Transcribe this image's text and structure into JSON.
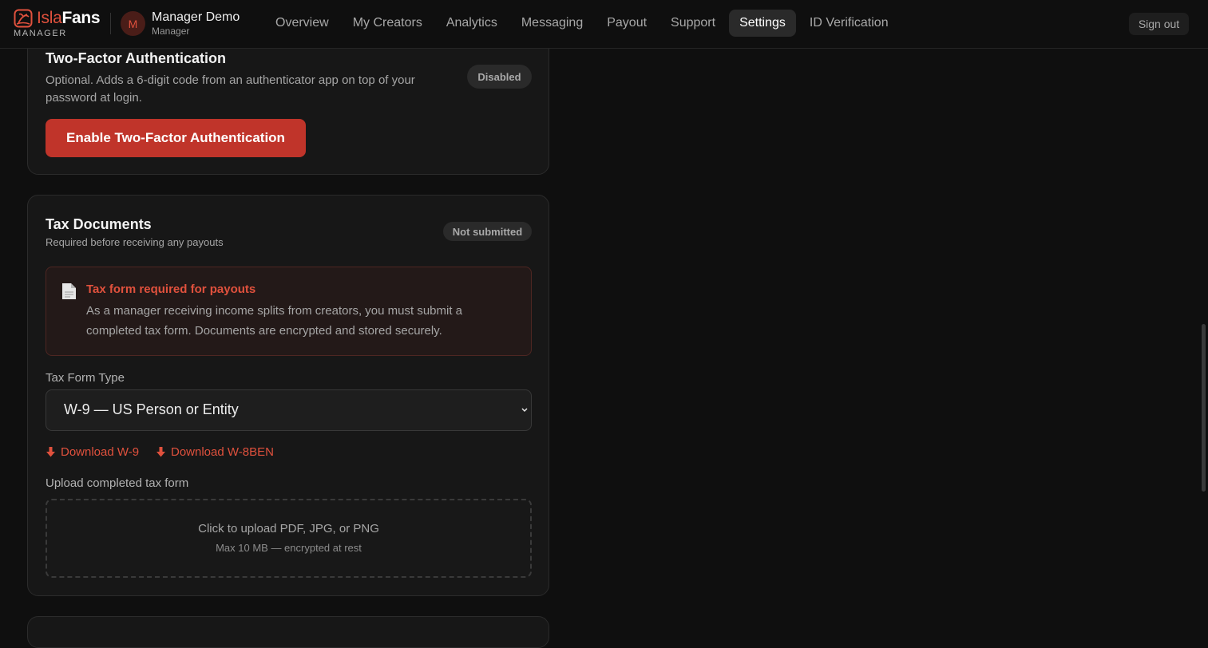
{
  "header": {
    "brand": {
      "part1": "Isla",
      "part2": "Fans",
      "subtitle": "MANAGER",
      "accent": "#e0513d"
    },
    "user": {
      "initial": "M",
      "name": "Manager Demo",
      "role": "Manager"
    },
    "nav": [
      {
        "label": "Overview",
        "active": false
      },
      {
        "label": "My Creators",
        "active": false
      },
      {
        "label": "Analytics",
        "active": false
      },
      {
        "label": "Messaging",
        "active": false
      },
      {
        "label": "Payout",
        "active": false
      },
      {
        "label": "Support",
        "active": false
      },
      {
        "label": "Settings",
        "active": true
      },
      {
        "label": "ID Verification",
        "active": false
      }
    ],
    "signout_label": "Sign out"
  },
  "two_factor": {
    "title": "Two-Factor Authentication",
    "description": "Optional. Adds a 6-digit code from an authenticator app on top of your password at login.",
    "status": "Disabled",
    "button_label": "Enable Two-Factor Authentication",
    "button_color": "#c0342a"
  },
  "tax": {
    "title": "Tax Documents",
    "subtitle": "Required before receiving any payouts",
    "status": "Not submitted",
    "alert": {
      "icon": "document-icon",
      "title": "Tax form required for payouts",
      "text": "As a manager receiving income splits from creators, you must submit a completed tax form. Documents are encrypted and stored securely."
    },
    "form_type_label": "Tax Form Type",
    "form_type_value": "W-9 — US Person or Entity",
    "downloads": [
      {
        "label": "Download W-9",
        "icon": "download-arrow-icon"
      },
      {
        "label": "Download W-8BEN",
        "icon": "download-arrow-icon"
      }
    ],
    "upload_label": "Upload completed tax form",
    "upload_main": "Click to upload PDF, JPG, or PNG",
    "upload_sub": "Max 10 MB — encrypted at rest"
  }
}
